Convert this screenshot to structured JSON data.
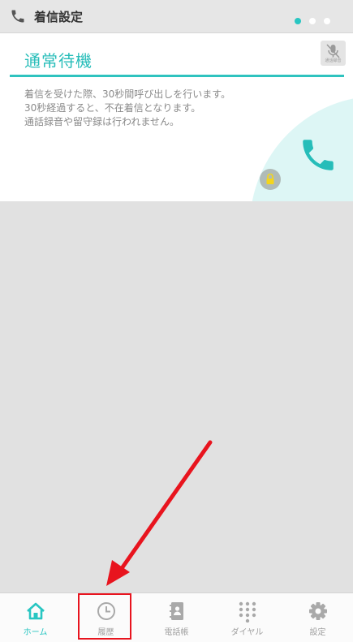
{
  "header": {
    "title": "着信設定",
    "icon": "phone-icon",
    "page_dots": 3,
    "active_dot_index": 0
  },
  "card": {
    "title": "通常待機",
    "recording_icon_label": "通話録音",
    "description": [
      "着信を受けた際、30秒間呼び出しを行います。",
      "30秒経過すると、不在着信となります。",
      "通話録音や留守録は行われません。"
    ],
    "icons": [
      "lock-icon",
      "phone-icon"
    ]
  },
  "nav": {
    "items": [
      {
        "label": "ホーム",
        "icon": "home-icon"
      },
      {
        "label": "履歴",
        "icon": "clock-icon"
      },
      {
        "label": "電話帳",
        "icon": "contacts-icon"
      },
      {
        "label": "ダイヤル",
        "icon": "dialpad-icon"
      },
      {
        "label": "設定",
        "icon": "gear-icon"
      }
    ],
    "active_index": 0
  },
  "colors": {
    "accent": "#28c6c2",
    "annotation_red": "#e8141e"
  }
}
